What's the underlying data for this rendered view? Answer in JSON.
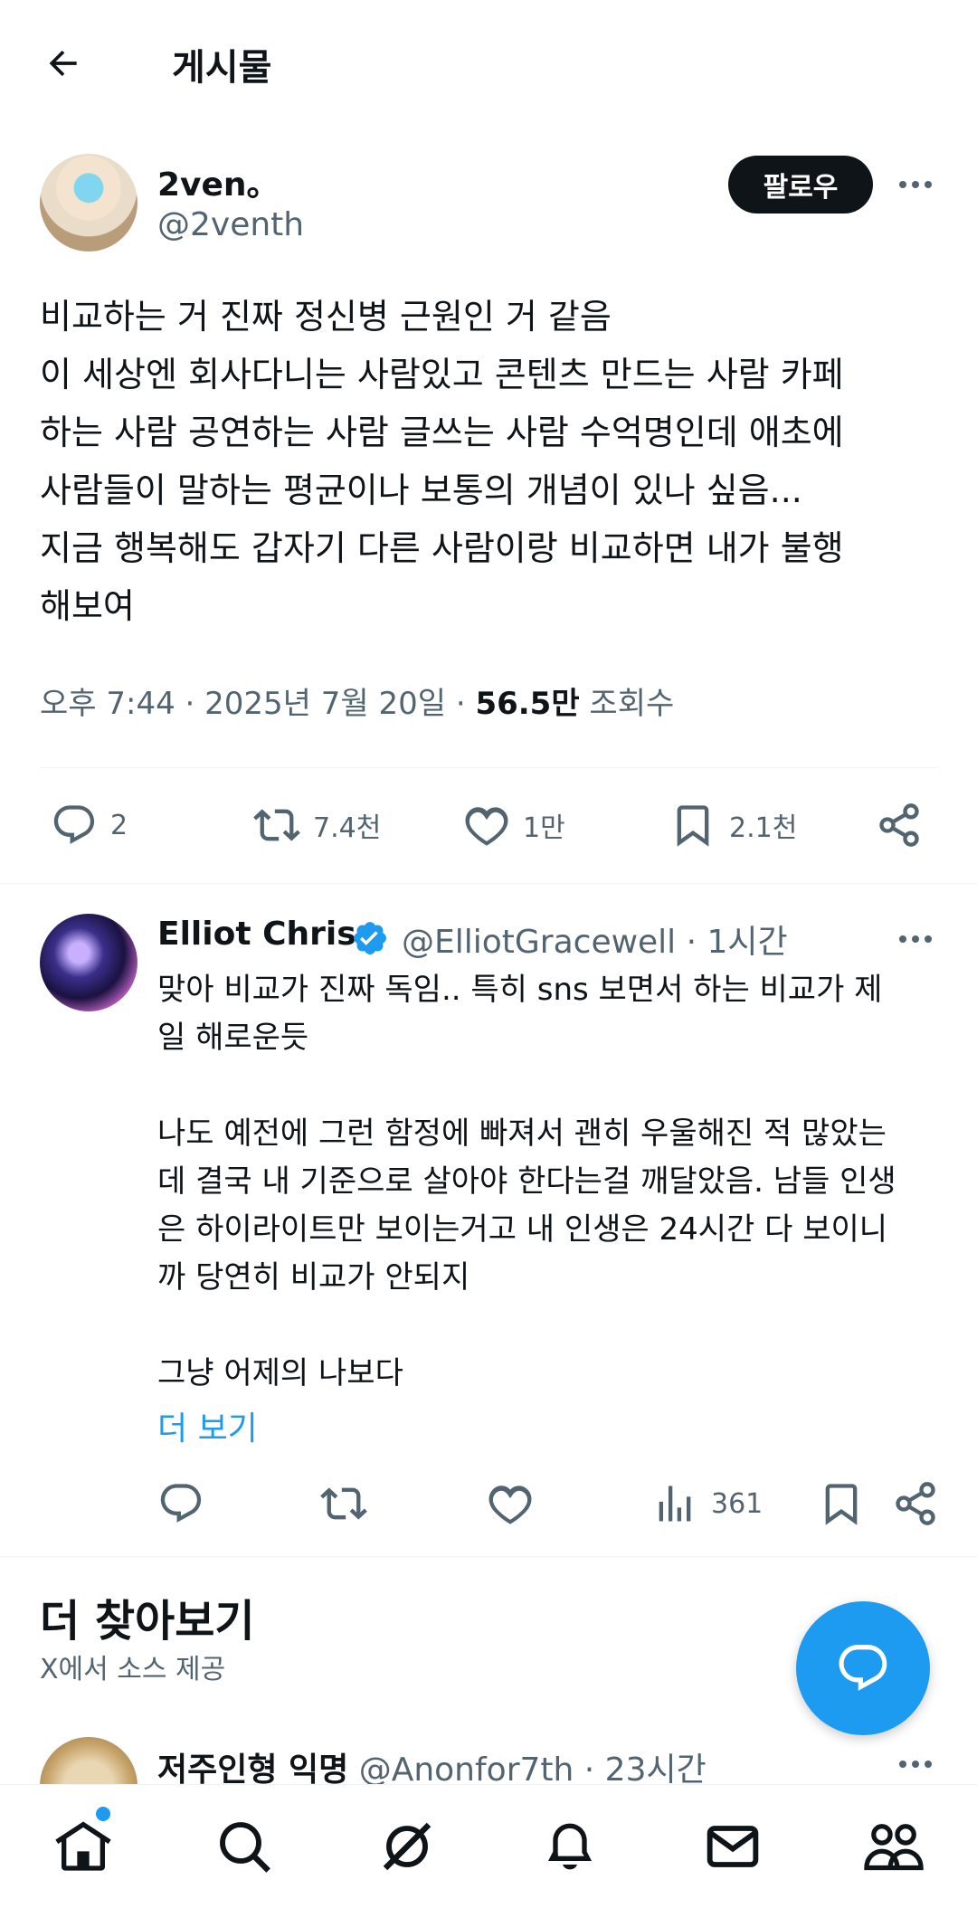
{
  "header": {
    "title": "게시물"
  },
  "post": {
    "author_name": "2ven。",
    "author_handle": "@2venth",
    "follow_label": "팔로우",
    "body": "비교하는 거 진짜 정신병 근원인 거 같음\n이 세상엔 회사다니는 사람있고 콘텐츠 만드는 사람 카페\n하는 사람 공연하는 사람 글쓰는 사람 수억명인데 애초에\n사람들이 말하는 평균이나 보통의 개념이 있나 싶음...\n지금 행복해도 갑자기 다른 사람이랑 비교하면 내가 불행\n해보여",
    "time": "오후 7:44 · 2025년 7월 20일 · ",
    "views_count": "56.5만",
    "views_label": " 조회수",
    "stats": {
      "replies": "2",
      "reposts": "7.4천",
      "likes": "1만",
      "bookmarks": "2.1천"
    }
  },
  "reply": {
    "author_name": "Elliot Chris",
    "author_handle": "@ElliotGracewell · 1시간",
    "body": "맞아 비교가 진짜 독임.. 특히 sns 보면서 하는 비교가 제\n일 해로운듯\n\n나도 예전에 그런 함정에 빠져서 괜히 우울해진 적 많았는\n데 결국 내 기준으로 살아야 한다는걸 깨달았음. 남들 인생\n은 하이라이트만 보이는거고 내 인생은 24시간 다 보이니\n까 당연히 비교가 안되지\n\n그냥 어제의 나보다",
    "more_label": "더 보기",
    "views": "361"
  },
  "explore": {
    "title": "더 찾아보기",
    "subtitle": "X에서 소스 제공",
    "next_author_name": "저주인형 익명",
    "next_author_handle": " @Anonfor7th · 23시간"
  },
  "colors": {
    "accent": "#1d9bf0",
    "text": "#0f1419",
    "secondary": "#536471"
  }
}
